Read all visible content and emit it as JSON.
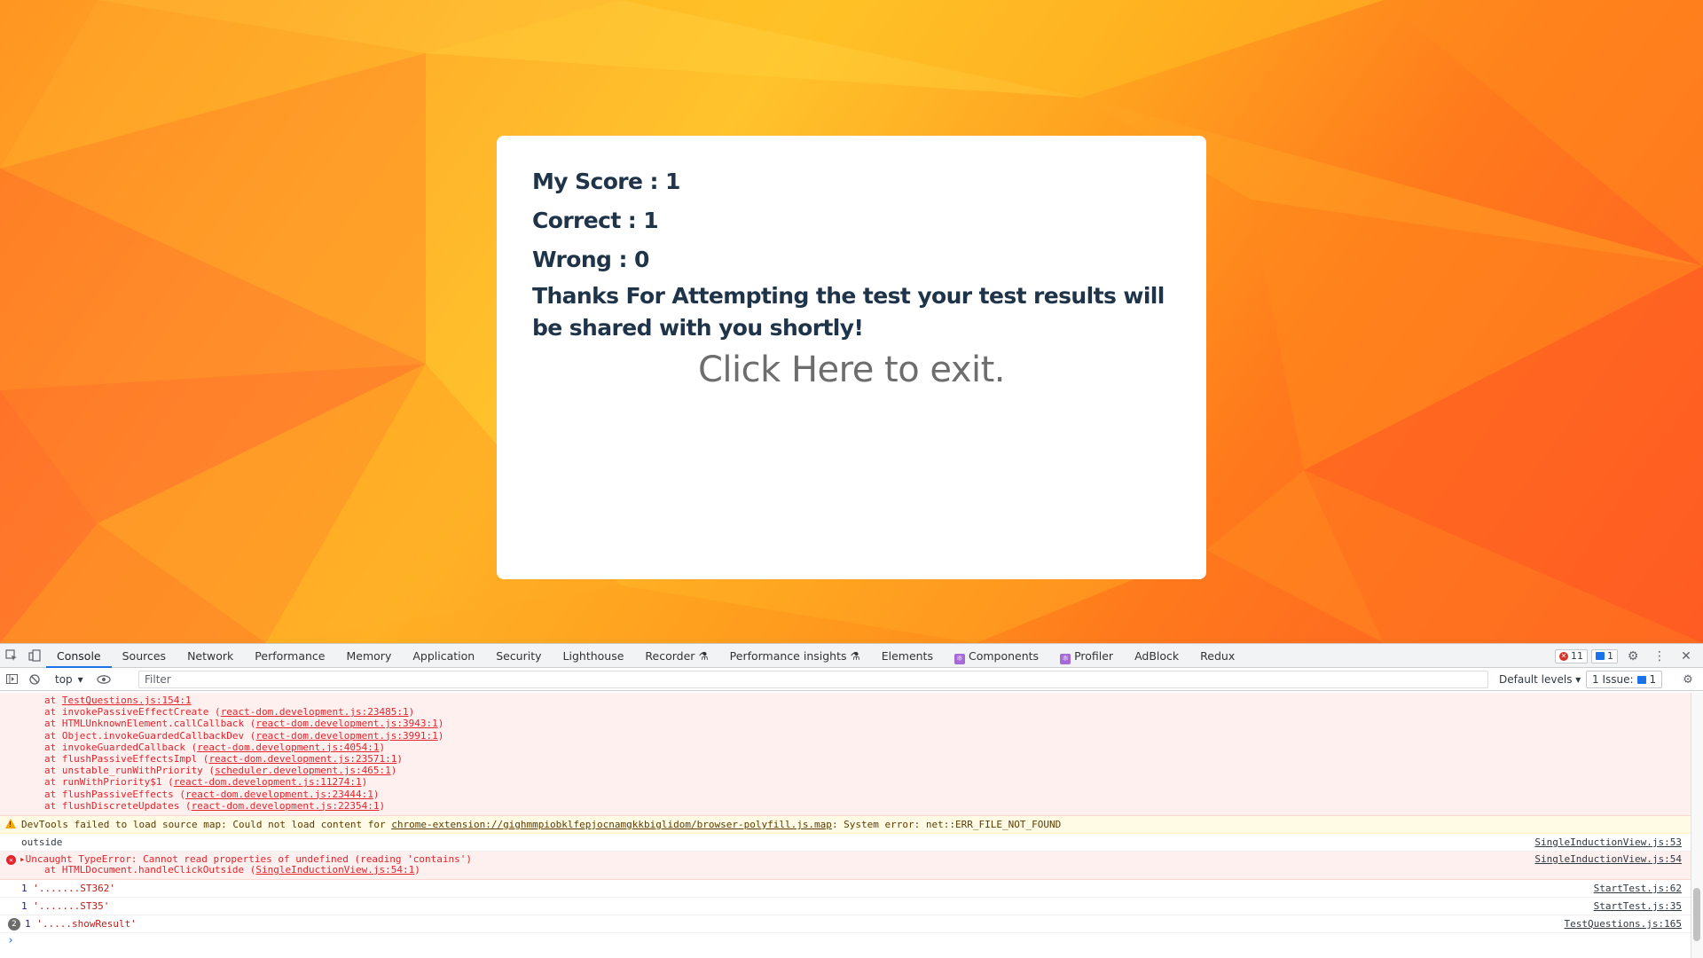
{
  "result": {
    "score_label": "My Score : 1",
    "correct_label": "Correct : 1",
    "wrong_label": "Wrong : 0",
    "thanks_text": "Thanks For Attempting the test your test results will be shared with you shortly!",
    "exit_label": "Click Here to exit."
  },
  "devtools": {
    "tabs": [
      "Console",
      "Sources",
      "Network",
      "Performance",
      "Memory",
      "Application",
      "Security",
      "Lighthouse",
      "Recorder",
      "Performance insights",
      "Elements",
      "Components",
      "Profiler",
      "AdBlock",
      "Redux"
    ],
    "active_tab": "Console",
    "error_count": "11",
    "message_count": "1",
    "context": "top",
    "filter_placeholder": "Filter",
    "levels": "Default levels",
    "issues_label": "1 Issue:",
    "issues_count": "1"
  },
  "console": {
    "stack": [
      {
        "pre": "at ",
        "link": "TestQuestions.js:154:1",
        "post": ""
      },
      {
        "pre": "at invokePassiveEffectCreate (",
        "link": "react-dom.development.js:23485:1",
        "post": ")"
      },
      {
        "pre": "at HTMLUnknownElement.callCallback (",
        "link": "react-dom.development.js:3943:1",
        "post": ")"
      },
      {
        "pre": "at Object.invokeGuardedCallbackDev (",
        "link": "react-dom.development.js:3991:1",
        "post": ")"
      },
      {
        "pre": "at invokeGuardedCallback (",
        "link": "react-dom.development.js:4054:1",
        "post": ")"
      },
      {
        "pre": "at flushPassiveEffectsImpl (",
        "link": "react-dom.development.js:23571:1",
        "post": ")"
      },
      {
        "pre": "at unstable_runWithPriority (",
        "link": "scheduler.development.js:465:1",
        "post": ")"
      },
      {
        "pre": "at runWithPriority$1 (",
        "link": "react-dom.development.js:11274:1",
        "post": ")"
      },
      {
        "pre": "at flushPassiveEffects (",
        "link": "react-dom.development.js:23444:1",
        "post": ")"
      },
      {
        "pre": "at flushDiscreteUpdates (",
        "link": "react-dom.development.js:22354:1",
        "post": ")"
      }
    ],
    "warning": {
      "pre": "DevTools failed to load source map: Could not load content for ",
      "link": "chrome-extension://gighmmpiobklfepjocnamgkkbiglidom/browser-polyfill.js.map",
      "post": ": System error: net::ERR_FILE_NOT_FOUND"
    },
    "log_outside": {
      "text": "outside",
      "source": "SingleInductionView.js:53"
    },
    "type_error": {
      "text": "Uncaught TypeError: Cannot read properties of undefined (reading 'contains')",
      "sub_pre": "at HTMLDocument.handleClickOutside (",
      "sub_link": "SingleInductionView.js:54:1",
      "sub_post": ")",
      "source": "SingleInductionView.js:54"
    },
    "logs": [
      {
        "num": "1",
        "str": "'.......ST362'",
        "source": "StartTest.js:62"
      },
      {
        "num": "1",
        "str": "'.......ST35'",
        "source": "StartTest.js:35"
      },
      {
        "count": "2",
        "num": "1",
        "str": "'.....showResult'",
        "source": "TestQuestions.js:165"
      }
    ],
    "prompt": "›"
  },
  "colors": {
    "accent": "#1a73e8",
    "error_text": "#e3242b",
    "error_bg": "#fff0f0",
    "warning_bg": "#fffbe5",
    "card_text": "#1f3449",
    "exit_text": "#6d6d6d"
  }
}
